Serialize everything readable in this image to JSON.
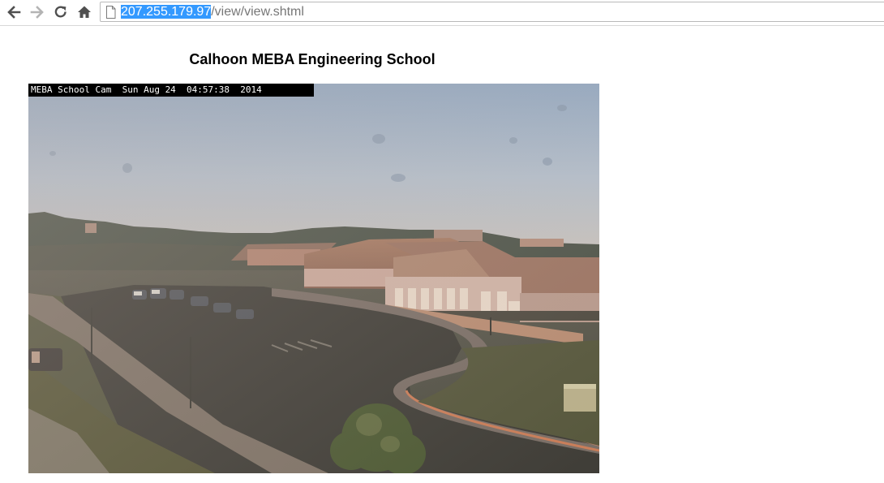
{
  "browser": {
    "address_bar": {
      "host": "207.255.179.97",
      "path": "/view/view.shtml"
    },
    "icons": {
      "back": "back-arrow-icon",
      "forward": "forward-arrow-icon",
      "reload": "reload-icon",
      "home": "home-icon",
      "page": "page-document-icon"
    }
  },
  "page": {
    "heading": "Calhoon MEBA Engineering School",
    "camera": {
      "overlay_text": "MEBA School Cam  Sun Aug 24  04:57:38  2014"
    }
  }
}
